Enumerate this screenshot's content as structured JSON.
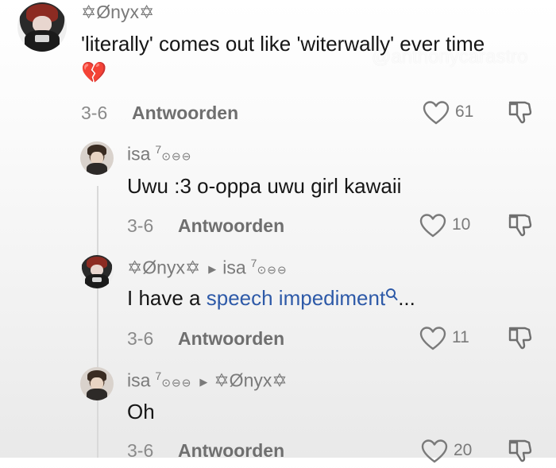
{
  "watermark": "@anthonycarastro",
  "comments": [
    {
      "username": "✡Ønyx✡",
      "text": "'literally' comes out like 'witerwally' ever time",
      "emoji": "💔",
      "date": "3-6",
      "reply_label": "Antwoorden",
      "likes": "61"
    },
    {
      "username": "isa",
      "username_sup": "7",
      "username_badges": "⊙⊖⊖",
      "text": "Uwu :3 o-oppa uwu girl kawaii",
      "date": "3-6",
      "reply_label": "Antwoorden",
      "likes": "10"
    },
    {
      "username": "✡Ønyx✡",
      "reply_to": "isa",
      "reply_to_sup": "7",
      "reply_to_badges": "⊙⊖⊖",
      "text_prefix": "I have a ",
      "text_link": "speech impediment",
      "text_suffix": "...",
      "date": "3-6",
      "reply_label": "Antwoorden",
      "likes": "11"
    },
    {
      "username": "isa",
      "username_sup": "7",
      "username_badges": "⊙⊖⊖",
      "reply_to": "✡Ønyx✡",
      "text": "Oh",
      "date": "3-6",
      "reply_label": "Antwoorden",
      "likes": "20"
    }
  ],
  "icons": {
    "heart": "heart-icon",
    "dislike": "thumbs-down-icon",
    "arrow": "triangle-right-icon",
    "search": "search-icon"
  }
}
